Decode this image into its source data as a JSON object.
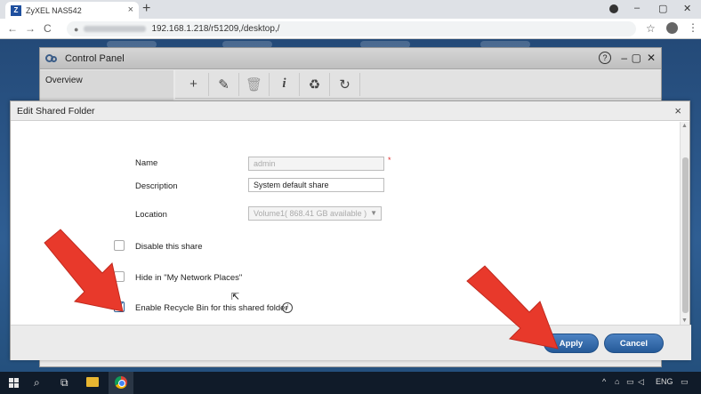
{
  "browser": {
    "tab_title": "ZyXEL NAS542",
    "tab_favicon": "Z",
    "url": "192.168.1.218/r51209,/desktop,/",
    "nav": {
      "back": "←",
      "forward": "→",
      "reload": "C"
    },
    "icons": {
      "star": "☆",
      "menu": "⋮",
      "close": "×",
      "new_tab": "+",
      "minimize": "–",
      "maximize": "▢",
      "window_close": "✕"
    }
  },
  "control_panel": {
    "title": "Control Panel",
    "sidebar_item": "Overview",
    "help": "?",
    "toolbar_icons": [
      "plus-icon",
      "edit-icon",
      "trash-icon",
      "info-icon",
      "recycle-icon",
      "refresh-icon"
    ],
    "toolbar_glyphs": [
      "+",
      "✎",
      "🗑",
      "i",
      "♻",
      "↻"
    ]
  },
  "dialog": {
    "title": "Edit Shared Folder",
    "close": "×",
    "fields": {
      "name_label": "Name",
      "name_value": "admin",
      "required_mark": "*",
      "description_label": "Description",
      "description_value": "System default share",
      "location_label": "Location",
      "location_value": "Volume1( 868.41 GB available )"
    },
    "options": {
      "disable_share": {
        "label": "Disable this share",
        "checked": false
      },
      "hide_network_places": {
        "label": "Hide in \"My Network Places\"",
        "checked": false
      },
      "enable_recycle_bin": {
        "label": "Enable Recycle Bin for this shared folder",
        "checked": true
      }
    },
    "info_glyph": "i",
    "buttons": {
      "apply": "Apply",
      "cancel": "Cancel"
    }
  },
  "taskbar": {
    "search_glyph": "⌕",
    "taskview_glyph": "⧉",
    "language": "ENG",
    "tray_glyphs": [
      "^",
      "⌂",
      "▭",
      "◁",
      "⚑"
    ],
    "notify_glyph": "▭"
  },
  "colors": {
    "accent": "#2d6bb0",
    "arrow": "#e8392b",
    "button": "#255a98"
  }
}
